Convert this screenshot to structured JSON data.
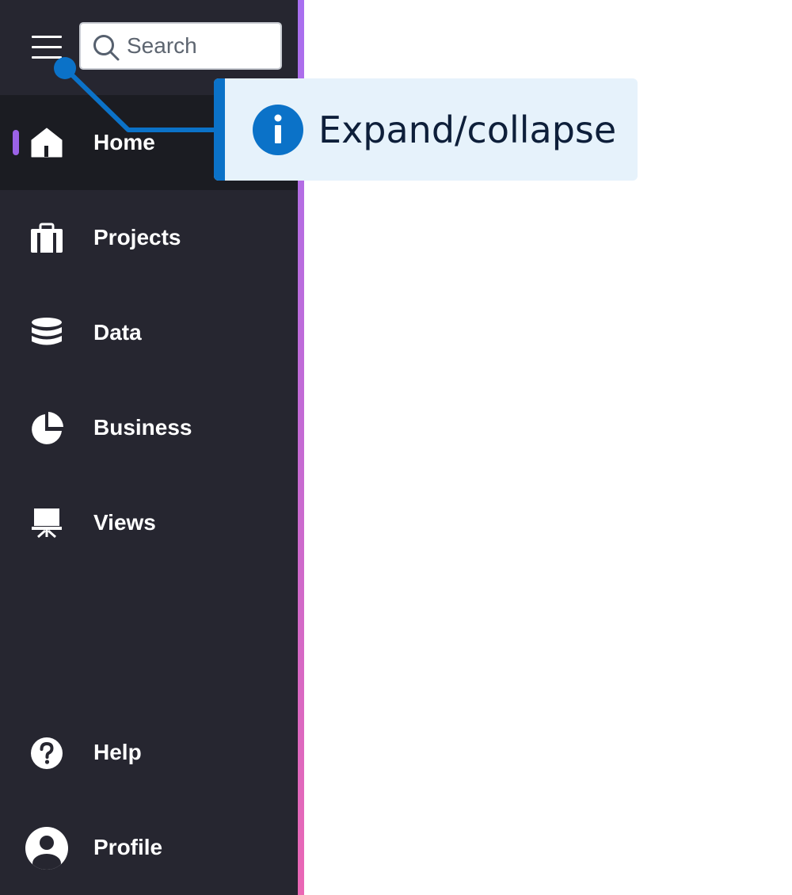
{
  "search": {
    "placeholder": "Search"
  },
  "nav": {
    "items": [
      {
        "label": "Home",
        "icon": "home-icon",
        "active": true
      },
      {
        "label": "Projects",
        "icon": "briefcase-icon"
      },
      {
        "label": "Data",
        "icon": "database-icon"
      },
      {
        "label": "Business",
        "icon": "pie-chart-icon"
      },
      {
        "label": "Views",
        "icon": "presentation-icon"
      }
    ],
    "bottom": [
      {
        "label": "Help",
        "icon": "help-icon"
      },
      {
        "label": "Profile",
        "icon": "profile-icon"
      }
    ]
  },
  "tooltip": {
    "text": "Expand/collapse",
    "icon": "info-icon"
  },
  "colors": {
    "sidebar_bg": "#262630",
    "active_bg": "#1b1c22",
    "accent_gradient": [
      "#a86ff0",
      "#ea67b4"
    ],
    "active_indicator": "#9b62e6",
    "tooltip_bg": "#e6f2fb",
    "tooltip_accent": "#0b72c8"
  }
}
